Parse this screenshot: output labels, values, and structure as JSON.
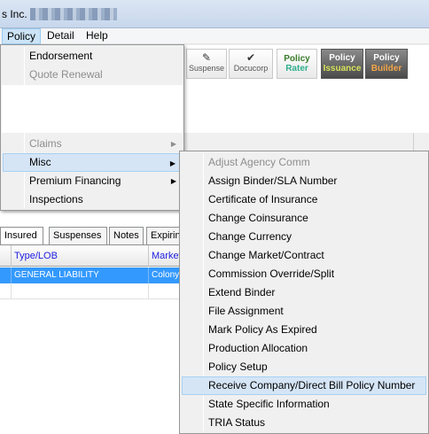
{
  "window": {
    "title_visible": "s Inc."
  },
  "menubar": {
    "items": [
      "Policy",
      "Detail",
      "Help"
    ]
  },
  "toolbar": {
    "suspense": "Suspense",
    "docucorp": "Docucorp",
    "rater_top": "Policy",
    "rater_bottom": "Rater",
    "issuance_top": "Policy",
    "issuance_bottom": "Issuance",
    "builder_top": "Policy",
    "builder_bottom": "Builder"
  },
  "policy_menu": {
    "endorsement": "Endorsement",
    "quote_renewal": "Quote Renewal",
    "claims": "Claims",
    "misc": "Misc",
    "premium_financing": "Premium Financing",
    "inspections": "Inspections"
  },
  "tabs": [
    "Insured",
    "Suspenses",
    "Notes",
    "Expirin"
  ],
  "grid": {
    "columns": [
      "",
      "Type/LOB",
      "Market"
    ],
    "rows": [
      [
        "",
        "GENERAL LIABILITY",
        "Colony"
      ]
    ]
  },
  "misc_menu": {
    "items": [
      "Adjust Agency Comm",
      "Assign Binder/SLA Number",
      "Certificate of Insurance",
      "Change Coinsurance",
      "Change Currency",
      "Change Market/Contract",
      "Commission Override/Split",
      "Extend Binder",
      "File Assignment",
      "Mark Policy As Expired",
      "Production Allocation",
      "Policy Setup",
      "Receive Company/Direct Bill Policy Number",
      "State Specific Information",
      "TRIA Status"
    ],
    "highlighted_index": 12,
    "disabled_index": 0
  },
  "colors": {
    "selection": "#3399ff",
    "menu_hover": "#d5e5f6",
    "header_text": "#1b1be0"
  }
}
